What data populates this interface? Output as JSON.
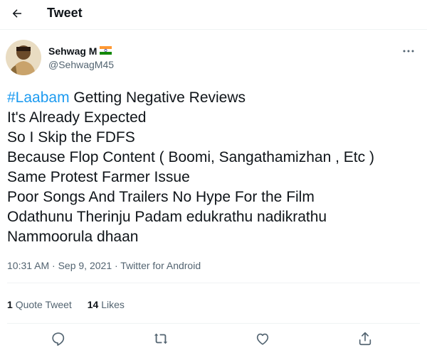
{
  "header": {
    "title": "Tweet",
    "back_icon": "arrow-left-icon"
  },
  "tweet": {
    "author": {
      "display_name": "Sehwag M",
      "flag_icon": "india-flag-icon",
      "handle": "@SehwagM45"
    },
    "hashtag": "#Laabam",
    "first_line_rest": " Getting Negative Reviews",
    "lines": [
      "It's Already Expected",
      "So I Skip the FDFS",
      "Because Flop Content ( Boomi, Sangathamizhan , Etc )",
      "Same Protest Farmer Issue",
      "Poor Songs And Trailers No Hype For the Film",
      "Odathunu Therinju Padam edukrathu nadikrathu",
      "Nammoorula dhaan"
    ],
    "meta": "10:31 AM · Sep 9, 2021 · Twitter for Android",
    "stats": {
      "quote_count": "1",
      "quote_label": "Quote Tweet",
      "likes_count": "14",
      "likes_label": "Likes"
    }
  },
  "actions": [
    "reply-icon",
    "retweet-icon",
    "like-icon",
    "share-icon"
  ],
  "colors": {
    "accent": "#1d9bf0",
    "secondary_text": "#536471",
    "primary_text": "#0f1419",
    "divider": "#eff3f4"
  }
}
